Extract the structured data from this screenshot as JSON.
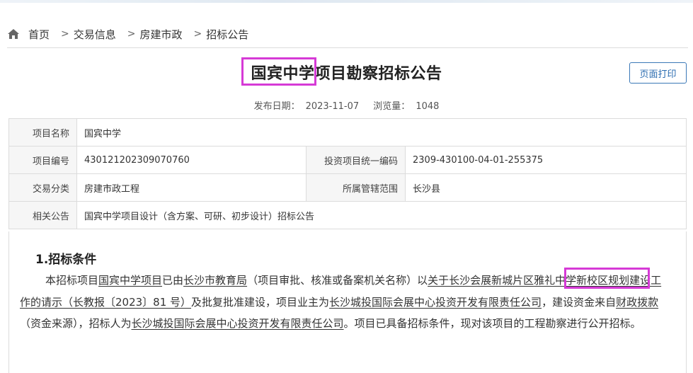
{
  "breadcrumb": {
    "home": "首页",
    "items": [
      "交易信息",
      "房建市政",
      "招标公告"
    ],
    "separator": ">"
  },
  "title": {
    "highlight": "国宾中学",
    "rest": "项目勘察招标公告"
  },
  "print_button": "页面打印",
  "meta": {
    "date_label": "发布日期：",
    "date": "2023-11-07",
    "views_label": "浏览量：",
    "views": "1048"
  },
  "info_table": {
    "project_name_label": "项目名称",
    "project_name": "国宾中学",
    "project_no_label": "项目编号",
    "project_no": "430121202309070760",
    "invest_code_label": "投资项目统一编码",
    "invest_code": "2309-430100-04-01-255375",
    "category_label": "交易分类",
    "category": "房建市政工程",
    "scope_label": "所属管辖范围",
    "scope": "长沙县",
    "related_label": "相关公告",
    "related": "国宾中学项目设计（含方案、可研、初步设计）招标公告"
  },
  "section": {
    "title": "1.招标条件",
    "p1": "本招标项目",
    "u1": "国宾中学项目",
    "p2": "已由",
    "u2": "长沙市教育局",
    "p3": "（项目审批、核准或备案机关名称）以",
    "u3a": "关于长沙会展新城片区",
    "u3b": "雅礼中学新校区",
    "u3c": "规划建设工作的请示（长教报〔2023〕81 号）",
    "p4": "及批复批准建设，项目业主为",
    "u4": "长沙城投国际会展中心投资开发有限责任公司",
    "p5": "，建设资金来自",
    "u5": "财政拨款",
    "p6": "（资金来源），招标人为",
    "u6": "长沙城投国际会展中心投资开发有限责任公司",
    "p7": "。项目已具备招标条件，现对该项目的工程勘察进行公开招标。"
  },
  "colors": {
    "highlight_box": "#d63ad6",
    "link_button": "#2b6cb0"
  }
}
